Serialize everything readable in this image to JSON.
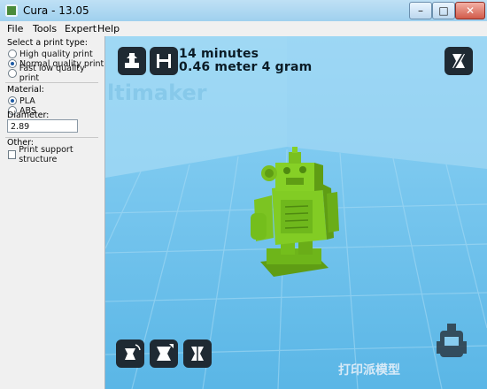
{
  "window": {
    "title": "Cura - 13.05",
    "minimize_label": "–",
    "maximize_label": "□",
    "close_label": "✕"
  },
  "menu": {
    "items": [
      "File",
      "Tools",
      "Expert",
      "Help"
    ]
  },
  "panel": {
    "print_type_label": "Select a print type:",
    "print_types": [
      {
        "label": "High quality print",
        "selected": false
      },
      {
        "label": "Normal quality print",
        "selected": true
      },
      {
        "label": "Fast low quality print",
        "selected": false
      }
    ],
    "material_label": "Material:",
    "materials": [
      {
        "label": "PLA",
        "selected": true
      },
      {
        "label": "ABS",
        "selected": false
      }
    ],
    "diameter_label": "Diameter:",
    "diameter_value": "2.89",
    "other_label": "Other:",
    "support_label": "Print support structure",
    "support_checked": false
  },
  "viewport": {
    "print_time": "14 minutes",
    "print_material": "0.46 meter 4 gram",
    "watermark": "打印派模型",
    "colors": {
      "bed": "#8fd0f1",
      "model": "#7ac020",
      "button": "#1f2a33"
    },
    "buttons": [
      "load-model-icon",
      "save-gcode-icon",
      "view-mode-icon",
      "rotate-icon",
      "scale-icon",
      "mirror-icon"
    ]
  }
}
